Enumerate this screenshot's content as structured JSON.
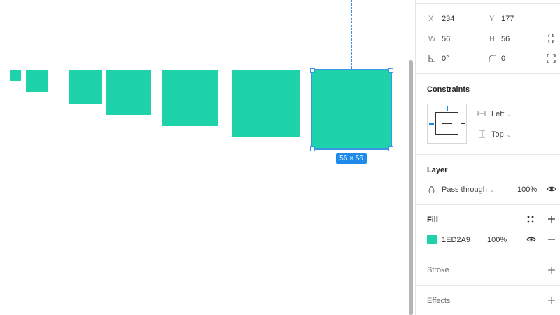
{
  "canvas": {
    "fill_color": "#1ED2A9",
    "selection_color": "#3a97e8",
    "size_badge": "56 × 56"
  },
  "design": {
    "x_label": "X",
    "x_value": "234",
    "y_label": "Y",
    "y_value": "177",
    "w_label": "W",
    "w_value": "56",
    "h_label": "H",
    "h_value": "56",
    "rotation_value": "0°",
    "radius_value": "0"
  },
  "constraints": {
    "title": "Constraints",
    "horizontal": "Left",
    "vertical": "Top"
  },
  "layer": {
    "title": "Layer",
    "blend_mode": "Pass through",
    "opacity": "100%"
  },
  "fill": {
    "title": "Fill",
    "hex": "1ED2A9",
    "opacity": "100%",
    "color": "#1ED2A9"
  },
  "stroke": {
    "title": "Stroke"
  },
  "effects": {
    "title": "Effects"
  }
}
